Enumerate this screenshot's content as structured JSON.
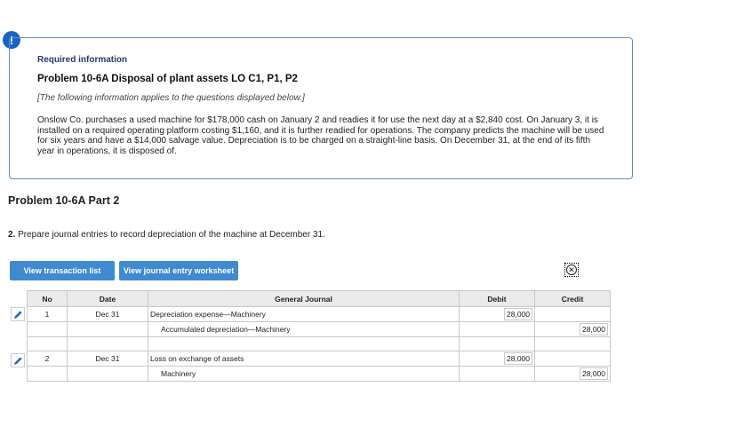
{
  "alert": {
    "symbol": "!"
  },
  "info": {
    "heading": "Required information",
    "title": "Problem 10-6A Disposal of plant assets LO C1, P1, P2",
    "note": "[The following information applies to the questions displayed below.]",
    "body": "Onslow Co. purchases a used machine for $178,000 cash on January 2 and readies it for use the next day at a $2,840 cost. On January 3, it is installed on a required operating platform costing $1,160, and it is further readied for operations. The company predicts the machine will be used for six years and have a $14,000 salvage value. Depreciation is to be charged on a straight-line basis. On December 31, at the end of its fifth year in operations, it is disposed of."
  },
  "part_title": "Problem 10-6A Part 2",
  "question": {
    "number": "2.",
    "text": " Prepare journal entries to record depreciation of the machine at December 31."
  },
  "buttons": {
    "view_transaction_list": "View transaction list",
    "view_journal_entry_worksheet": "View journal entry worksheet"
  },
  "table": {
    "headers": {
      "no": "No",
      "date": "Date",
      "general_journal": "General Journal",
      "debit": "Debit",
      "credit": "Credit"
    },
    "entries": [
      {
        "no": "1",
        "date": "Dec 31",
        "debit_account": "Depreciation expense—Machinery",
        "debit_amount": "28,000",
        "credit_account": "Accumulated depreciation—Machinery",
        "credit_amount": "28,000"
      },
      {
        "no": "2",
        "date": "Dec 31",
        "debit_account": "Loss on exchange of assets",
        "debit_amount": "28,000",
        "credit_account": "Machinery",
        "credit_amount": "28,000"
      }
    ]
  }
}
